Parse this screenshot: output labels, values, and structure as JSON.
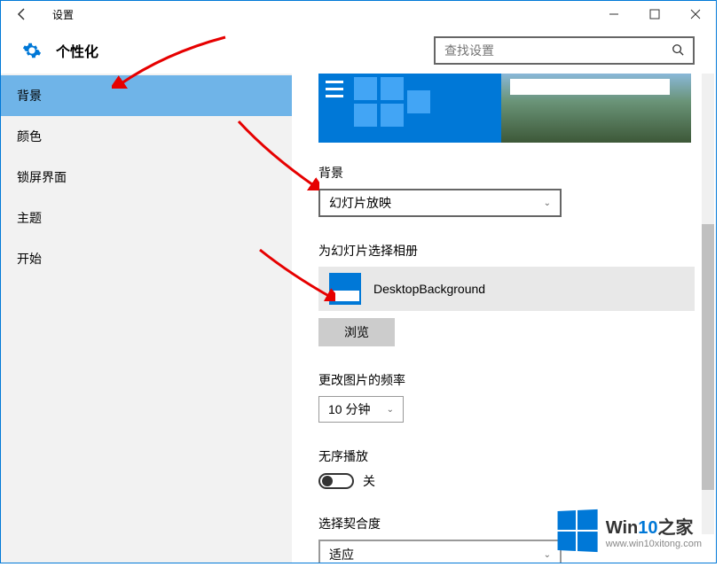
{
  "window": {
    "title": "设置",
    "header_title": "个性化",
    "search_placeholder": "查找设置"
  },
  "sidebar": {
    "items": [
      {
        "label": "背景",
        "active": true
      },
      {
        "label": "颜色",
        "active": false
      },
      {
        "label": "锁屏界面",
        "active": false
      },
      {
        "label": "主题",
        "active": false
      },
      {
        "label": "开始",
        "active": false
      }
    ]
  },
  "content": {
    "background_label": "背景",
    "background_dropdown": "幻灯片放映",
    "album_label": "为幻灯片选择相册",
    "album_name": "DesktopBackground",
    "browse_button": "浏览",
    "frequency_label": "更改图片的频率",
    "frequency_value": "10 分钟",
    "shuffle_label": "无序播放",
    "shuffle_state": "关",
    "fit_label": "选择契合度",
    "fit_value": "适应"
  },
  "watermark": {
    "brand_prefix": "Win",
    "brand_mid": "10",
    "brand_suffix": "之家",
    "url": "www.win10xitong.com"
  }
}
